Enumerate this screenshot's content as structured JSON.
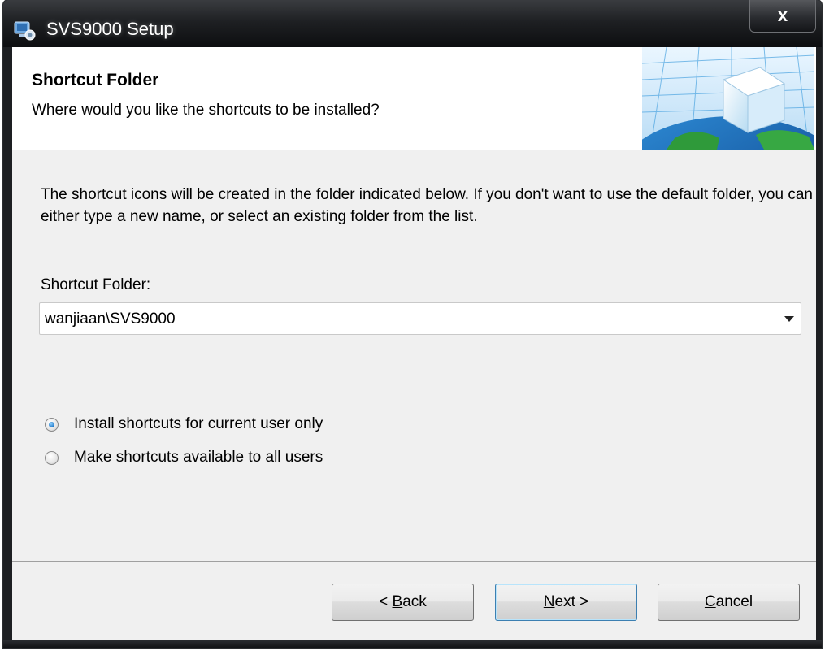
{
  "window": {
    "title": "SVS9000 Setup",
    "close_label": "x"
  },
  "header": {
    "title": "Shortcut Folder",
    "subtitle": "Where would you like the shortcuts to be installed?"
  },
  "body": {
    "description": "The shortcut icons will be created in the folder indicated below. If you don't want to use the default folder, you can either type a new name, or select an existing folder from the list.",
    "folder_label": "Shortcut Folder:",
    "folder_value": "wanjiaan\\SVS9000"
  },
  "options": [
    {
      "label": "Install shortcuts for current user only",
      "checked": true
    },
    {
      "label": "Make shortcuts available to all users",
      "checked": false
    }
  ],
  "buttons": {
    "back": {
      "prefix": "< ",
      "accel": "B",
      "rest": "ack"
    },
    "next": {
      "accel": "N",
      "rest": "ext >"
    },
    "cancel": {
      "accel": "C",
      "rest": "ancel"
    }
  },
  "colors": {
    "titlebar": "#1d1f22",
    "client_bg": "#f0f0f0",
    "header_bg": "#ffffff",
    "radio_selected": "#1f78c8",
    "default_button_border": "#3c7fb1"
  },
  "icons": {
    "app": "setup-installer-icon",
    "header_graphic": "globe-cube-graphic",
    "combo": "chevron-down-icon"
  }
}
